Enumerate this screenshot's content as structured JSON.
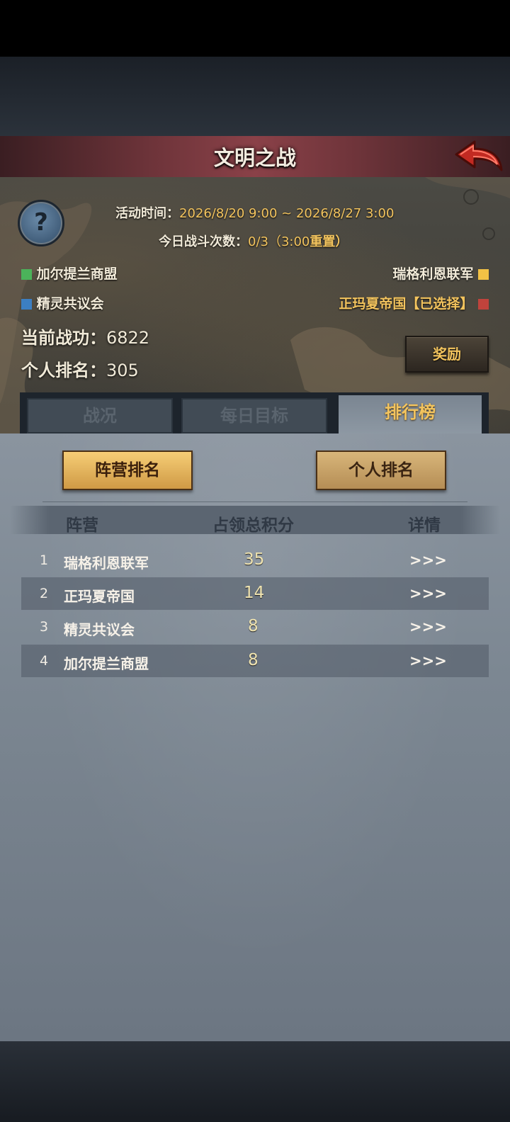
{
  "header": {
    "title": "文明之战"
  },
  "info": {
    "activity_label": "活动时间：",
    "activity_value": "2026/8/20 9:00 ~ 2026/8/27 3:00",
    "battles_label": "今日战斗次数：",
    "battles_value": "0/3（3:00",
    "battles_reset": "重置）"
  },
  "factions": [
    {
      "name": "加尔提兰商盟",
      "color": "#4bb35a"
    },
    {
      "name": "瑞格利恩联军",
      "color": "#f3c245"
    },
    {
      "name": "精灵共议会",
      "color": "#3c7fc2"
    },
    {
      "name": "正玛夏帝国【已选择】",
      "color": "#c0433c"
    }
  ],
  "stats": {
    "merit_label": "当前战功：",
    "merit_value": "6822",
    "rank_label": "个人排名：",
    "rank_value": "305"
  },
  "reward_label": "奖励",
  "tabs": [
    {
      "label": "战况",
      "active": false
    },
    {
      "label": "每日目标",
      "active": false
    },
    {
      "label": "排行榜",
      "active": true
    }
  ],
  "sub_tabs": {
    "camp": "阵营排名",
    "personal": "个人排名"
  },
  "table": {
    "headers": [
      "阵营",
      "占领总积分",
      "详情"
    ],
    "rows": [
      {
        "rank": "1",
        "name": "瑞格利恩联军",
        "score": "35",
        "detail": ">>>"
      },
      {
        "rank": "2",
        "name": "正玛夏帝国",
        "score": "14",
        "detail": ">>>"
      },
      {
        "rank": "3",
        "name": "精灵共议会",
        "score": "8",
        "detail": ">>>"
      },
      {
        "rank": "4",
        "name": "加尔提兰商盟",
        "score": "8",
        "detail": ">>>"
      }
    ]
  },
  "icons": {
    "help": "question-mark-icon",
    "back": "back-arrow-icon"
  }
}
